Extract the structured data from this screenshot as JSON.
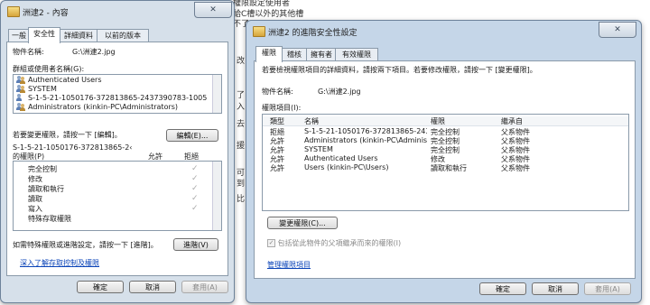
{
  "background_doc": {
    "lines": [
      "權限設定使用者",
      "給C槽以外的其他槽",
      "不了"
    ],
    "side_chars": [
      "改",
      "了",
      "入",
      "去",
      "援",
      "可",
      "到",
      "比"
    ]
  },
  "properties_window": {
    "title": "洲逮2 - 內容",
    "close_label": "✕",
    "tabs": [
      "一般",
      "安全性",
      "詳細資料",
      "以前的版本"
    ],
    "object_name_label": "物件名稱:",
    "object_name_value": "G:\\洲逮2.jpg",
    "groups_label": "群組或使用者名稱(G):",
    "users": [
      "Authenticated Users",
      "SYSTEM",
      "S-1-5-21-1050176-372813865-2437390783-1005",
      "Administrators (kinkin-PC\\Administrators)"
    ],
    "change_perm_hint": "若要變更權限，請按一下 [編輯]。",
    "edit_button": "編輯(E)...",
    "perm_for_label": "S-1-5-21-1050176-372813865-2‹",
    "perm_for_label2": "的權限(P)",
    "allow_header": "允許",
    "deny_header": "拒絕",
    "permissions": [
      {
        "name": "完全控制",
        "deny": "✓"
      },
      {
        "name": "修改",
        "deny": "✓"
      },
      {
        "name": "讀取和執行",
        "deny": "✓"
      },
      {
        "name": "讀取",
        "deny": "✓"
      },
      {
        "name": "寫入",
        "deny": "✓"
      },
      {
        "name": "特殊存取權限",
        "deny": ""
      }
    ],
    "advanced_hint": "如需特殊權限或進階設定，請按一下 [進階]。",
    "advanced_button": "進階(V)",
    "learn_link": "深入了解存取控制及權限",
    "ok_button": "確定",
    "cancel_button": "取消",
    "apply_button": "套用(A)"
  },
  "advanced_window": {
    "title": "洲逮2 的進階安全性設定",
    "close_label": "✕",
    "tabs": [
      "權限",
      "稽核",
      "擁有者",
      "有效權限"
    ],
    "intro": "若要檢視權限項目的詳細資料，請按兩下項目。若要修改權限，請按一下 [變更權限]。",
    "object_name_label": "物件名稱:",
    "object_name_value": "G:\\洲逮2.jpg",
    "entries_label": "權限項目(I):",
    "columns": [
      "類型",
      "名稱",
      "權限",
      "繼承自"
    ],
    "entries": [
      {
        "type": "拒絕",
        "name": "S-1-5-21-1050176-372813865-24373...",
        "perm": "完全控制",
        "inherit": "父系物件"
      },
      {
        "type": "允許",
        "name": "Administrators (kinkin-PC\\Administrat...",
        "perm": "完全控制",
        "inherit": "父系物件"
      },
      {
        "type": "允許",
        "name": "SYSTEM",
        "perm": "完全控制",
        "inherit": "父系物件"
      },
      {
        "type": "允許",
        "name": "Authenticated Users",
        "perm": "修改",
        "inherit": "父系物件"
      },
      {
        "type": "允許",
        "name": "Users (kinkin-PC\\Users)",
        "perm": "讀取和執行",
        "inherit": "父系物件"
      }
    ],
    "change_perm_button": "變更權限(C)...",
    "inherit_checkbox_label": "包括從此物件的父項繼承而來的權限(I)",
    "manage_link": "管理權限項目",
    "ok_button": "確定",
    "cancel_button": "取消",
    "apply_button": "套用(A)"
  }
}
